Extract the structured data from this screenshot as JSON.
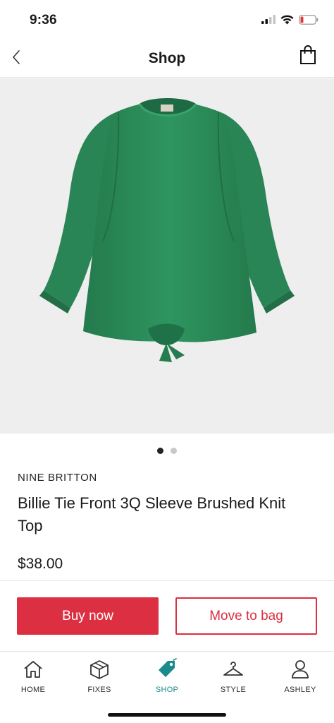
{
  "status_bar": {
    "time": "9:36",
    "icons": [
      "signal-icon",
      "wifi-icon",
      "battery-icon"
    ],
    "battery_color": "#e53935"
  },
  "nav": {
    "title": "Shop",
    "back_icon": "chevron-left-icon",
    "bag_icon": "shopping-bag-icon"
  },
  "product": {
    "image_alt": "green knit top",
    "image_colors": {
      "background": "#eeeeee",
      "garment": "#2a8a57"
    },
    "carousel": {
      "count": 2,
      "active_index": 0
    },
    "brand": "NINE BRITTON",
    "name": "Billie Tie Front 3Q Sleeve Brushed Knit Top",
    "price": "$38.00"
  },
  "actions": {
    "buy_now": "Buy now",
    "move_to_bag": "Move to bag",
    "accent_color": "#dc2f41"
  },
  "tabs": [
    {
      "label": "HOME",
      "icon": "home-icon",
      "active": false
    },
    {
      "label": "FIXES",
      "icon": "box-icon",
      "active": false
    },
    {
      "label": "SHOP",
      "icon": "tag-icon",
      "active": true
    },
    {
      "label": "STYLE",
      "icon": "hanger-icon",
      "active": false
    },
    {
      "label": "ASHLEY",
      "icon": "person-icon",
      "active": false
    }
  ],
  "active_tab_color": "#1b8a8c"
}
